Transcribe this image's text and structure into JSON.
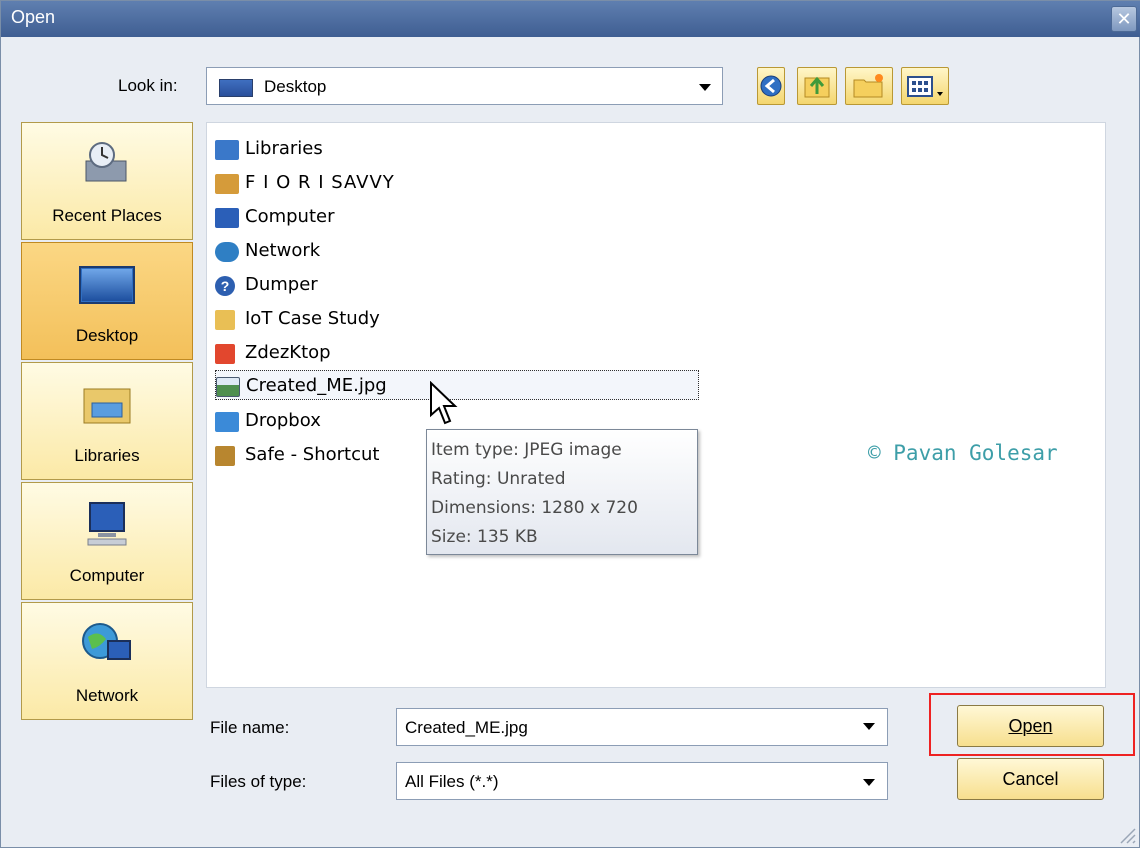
{
  "window": {
    "title": "Open",
    "close_icon": "close-icon"
  },
  "lookin": {
    "label": "Look in:",
    "value": "Desktop"
  },
  "toolbar": {
    "icons": [
      "back-icon",
      "up-folder-icon",
      "new-folder-icon",
      "view-menu-icon"
    ]
  },
  "places": [
    {
      "label": "Recent Places",
      "icon": "recent-places-icon",
      "selected": false
    },
    {
      "label": "Desktop",
      "icon": "desktop-icon",
      "selected": true
    },
    {
      "label": "Libraries",
      "icon": "libraries-icon",
      "selected": false
    },
    {
      "label": "Computer",
      "icon": "computer-icon",
      "selected": false
    },
    {
      "label": "Network",
      "icon": "network-icon",
      "selected": false
    }
  ],
  "files": [
    {
      "name": "Libraries",
      "icon": "libraries-icon",
      "color": "#3a78c9"
    },
    {
      "name": "F I O R I  SAVVY",
      "icon": "user-folder-icon",
      "color": "#d59b3a"
    },
    {
      "name": "Computer",
      "icon": "computer-icon",
      "color": "#2b5fb8"
    },
    {
      "name": "Network",
      "icon": "network-icon",
      "color": "#2f7fc4"
    },
    {
      "name": "Dumper",
      "icon": "help-icon",
      "color": "#2d5fb0"
    },
    {
      "name": "IoT Case Study",
      "icon": "folder-icon",
      "color": "#e9bf55"
    },
    {
      "name": "ZdezKtop",
      "icon": "app-icon",
      "color": "#e2472e"
    },
    {
      "name": "Created_ME.jpg",
      "icon": "image-file-icon",
      "color": "#4f8f4f",
      "focused": true
    },
    {
      "name": "Dropbox",
      "icon": "dropbox-shortcut-icon",
      "color": "#3b8ad8"
    },
    {
      "name": "Safe - Shortcut",
      "icon": "shortcut-icon",
      "color": "#b8862f"
    }
  ],
  "tooltip": {
    "type": "Item type: JPEG image",
    "rating": "Rating: Unrated",
    "dimensions": "Dimensions: 1280 x 720",
    "size": "Size: 135 KB"
  },
  "watermark": "© Pavan Golesar",
  "filename": {
    "label": "File name:",
    "value": "Created_ME.jpg"
  },
  "filetype": {
    "label": "Files of type:",
    "value": "All Files (*.*)"
  },
  "buttons": {
    "open": "Open",
    "cancel": "Cancel"
  }
}
